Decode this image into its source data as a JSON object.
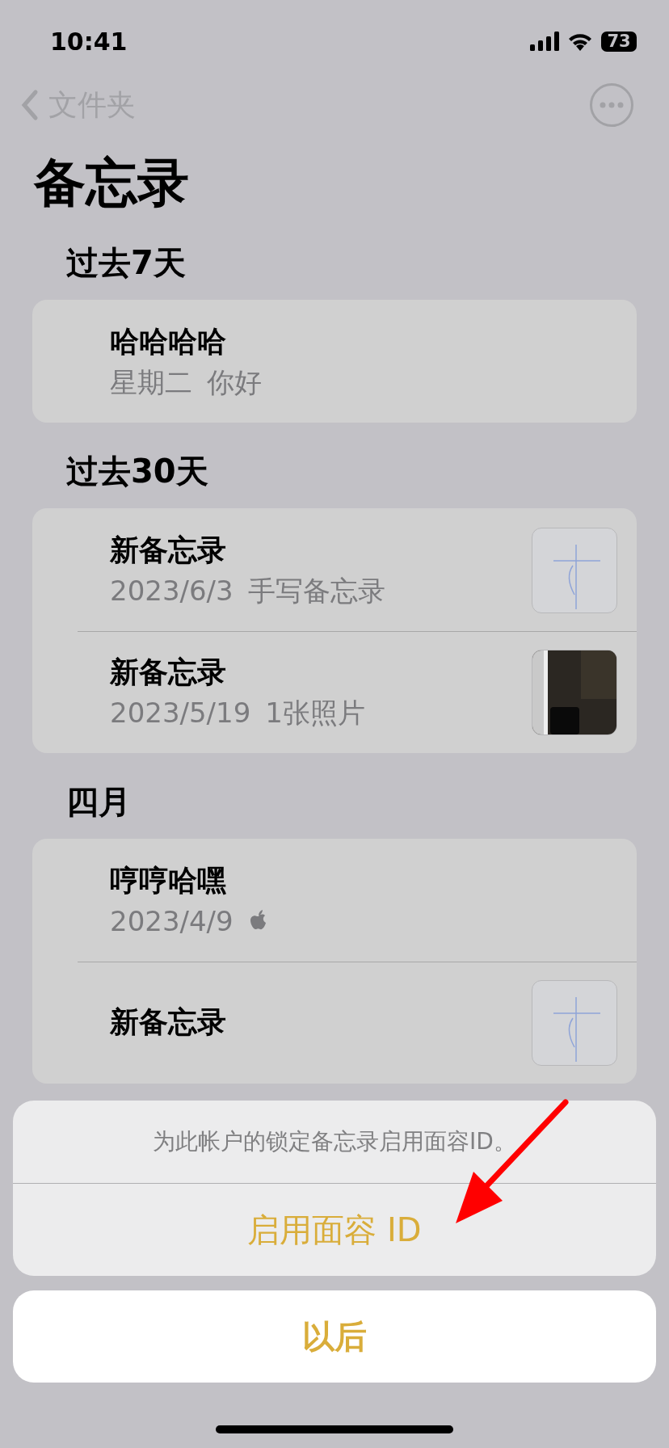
{
  "status_bar": {
    "time": "10:41",
    "battery": "73"
  },
  "nav": {
    "back_label": "文件夹"
  },
  "title": "备忘录",
  "sections": [
    {
      "heading": "过去7天",
      "notes": [
        {
          "kind": "text",
          "title": "哈哈哈哈",
          "date": "星期二",
          "preview": "你好"
        }
      ]
    },
    {
      "heading": "过去30天",
      "notes": [
        {
          "kind": "sketch",
          "title": "新备忘录",
          "date": "2023/6/3",
          "preview": "手写备忘录"
        },
        {
          "title": "新备忘录",
          "date": "2023/5/19",
          "preview": "1张照片"
        }
      ]
    },
    {
      "heading": "四月",
      "notes": [
        {
          "kind": "icon",
          "title": "哼哼哈嘿",
          "date": "2023/4/9"
        },
        {
          "kind": "sketch",
          "title": "新备忘录"
        }
      ]
    }
  ],
  "sheet": {
    "message": "为此帐户的锁定备忘录启用面容ID。",
    "action": "启用面容 ID",
    "cancel": "以后"
  },
  "annotations": [
    {
      "kind": "arrow"
    }
  ]
}
